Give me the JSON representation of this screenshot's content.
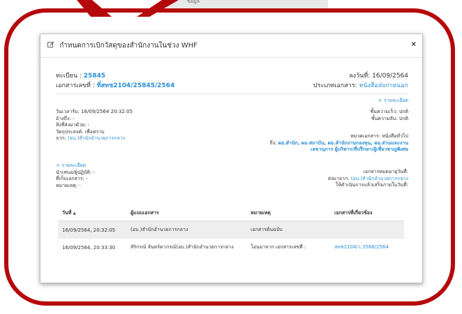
{
  "background": {
    "strip_text": "ข้อมูล"
  },
  "modal": {
    "title": "กำหนดการเบิกวัสดุของสำนักงานในช่วง WHF",
    "close_label": "×",
    "reg_label": "ทะเบียน : ",
    "reg_no": "25845",
    "doc_label": "เอกสารเลขที่ : ",
    "doc_no": "ที่สทช2104/25845/2564",
    "date_label": "ลงวันที่: ",
    "date_value": "16/09/2564",
    "type_label": "ประเภทเอกสาร: ",
    "type_value": "หนังสือส่งภายนอก",
    "detail_link": "+ รายละเอียด",
    "received": "วันเวลารับ: 16/09/2564 20:32:05",
    "refer": "อ้างถึง: -",
    "enclosed": "สิ่งที่ส่งมาด้วย: -",
    "purpose": "วัตถุประสงค์: เพื่อทราบ",
    "from_label": "จาก: ",
    "from_value": "(อบ.)สำนักอำนวยการกลาง",
    "urgency": "ชั้นความเร็ว: ปกติ",
    "secrecy": "ชั้นความลับ: ปกติ",
    "category": "หมวดเอกสาร: หนังสือทั่วไป",
    "to_label": "ถึง: ",
    "to_line1": "ผอ.สำนัก, ผอ.สถาบัน, ผอ.สำนักงานกองทุน, ผอ.ส่วนและงาน",
    "to_line2": "เลขานุการ ผู้บริหาร/ที่ปรึกษา/ผู้เชี่ยวชาญพิเศษ",
    "detail_link2": "+ รายละเอียด",
    "propose": "นำเสนอ/ผู้ปฏิบัติ: -",
    "storage": "ที่เก็บเอกสาร: -",
    "note": "หมายเหตุ: -",
    "expire": "เอกสารหมดอายุวันที่:",
    "sent_label": "ส่งมาจาก: ",
    "sent_value": "(อบ.)สำนักอำนวยการกลาง",
    "complete": "ให้ดำเนินการแล้วเสร็จภายในวันที่:"
  },
  "table": {
    "headers": [
      "วันที่",
      "ผู้แนบเอกสาร",
      "หมายเหตุ",
      "เอกสารที่เกี่ยวข้อง"
    ],
    "sort_indicator": "▲",
    "rows": [
      [
        "16/09/2564, 20:32:05",
        "(อบ.)สำนักอำนวยการกลาง",
        "เอกสารต้นฉบับ",
        ""
      ],
      [
        "16/09/2564, 20:33:30",
        "สิริกรณ์ จันทร์ดาภรณ์(อบ.)สำนักอำนวยการกลาง",
        "โอนมาจาก เอกสารเลขที่ :",
        "สทช2104/ว.3568/2564"
      ]
    ]
  },
  "colors": {
    "callout": "#b5080b",
    "link": "#2a8fd6"
  }
}
